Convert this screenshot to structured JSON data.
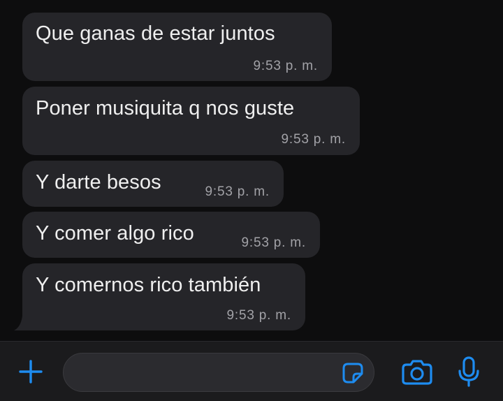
{
  "messages": [
    {
      "text": "Que ganas de estar juntos",
      "time": "9:53 p. m."
    },
    {
      "text": "Poner musiquita q nos guste",
      "time": "9:53 p. m."
    },
    {
      "text": "Y darte besos",
      "time": "9:53 p. m."
    },
    {
      "text": "Y comer algo rico",
      "time": "9:53 p. m."
    },
    {
      "text": "Y comernos rico también",
      "time": "9:53 p. m."
    }
  ],
  "composer": {
    "input_value": "",
    "icons": [
      "plus-icon",
      "sticker-icon",
      "camera-icon",
      "microphone-icon"
    ]
  },
  "colors": {
    "background": "#0d0d0e",
    "bubble": "#252529",
    "accent": "#1e8cf0",
    "time_text": "#a2a2a7"
  }
}
